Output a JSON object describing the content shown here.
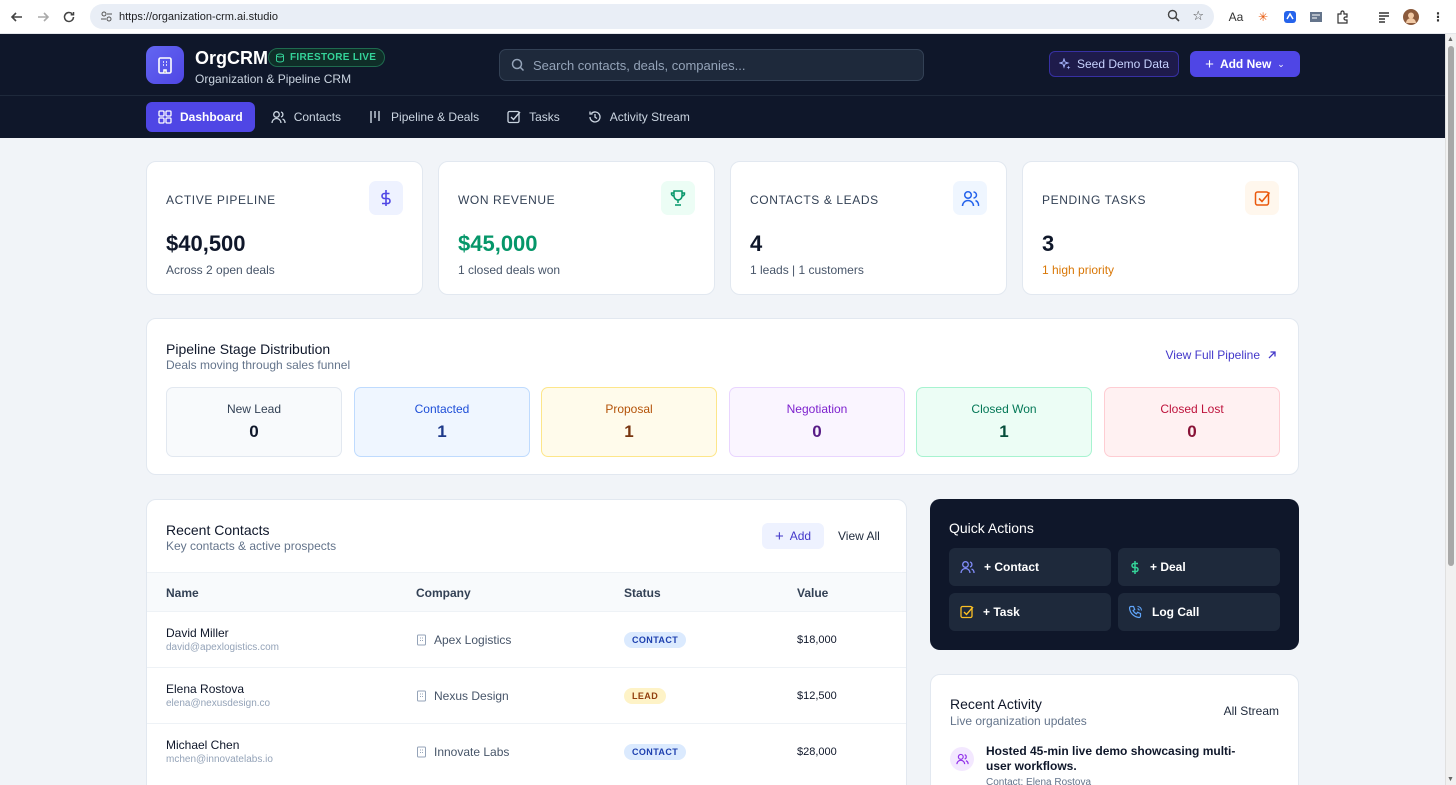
{
  "browser": {
    "url": "https://organization-crm.ai.studio"
  },
  "header": {
    "brand": "OrgCRM",
    "live_badge": "FIRESTORE LIVE",
    "subtitle": "Organization & Pipeline CRM",
    "search_placeholder": "Search contacts, deals, companies...",
    "seed_label": "Seed Demo Data",
    "add_label": "Add New"
  },
  "tabs": [
    {
      "label": "Dashboard",
      "active": true
    },
    {
      "label": "Contacts"
    },
    {
      "label": "Pipeline & Deals"
    },
    {
      "label": "Tasks"
    },
    {
      "label": "Activity Stream"
    }
  ],
  "stats": [
    {
      "label": "ACTIVE PIPELINE",
      "value": "$40,500",
      "sub": "Across 2 open deals"
    },
    {
      "label": "WON REVENUE",
      "value": "$45,000",
      "sub": "1 closed deals won"
    },
    {
      "label": "CONTACTS & LEADS",
      "value": "4",
      "sub": "1 leads | 1 customers"
    },
    {
      "label": "PENDING TASKS",
      "value": "3",
      "sub": "1 high priority"
    }
  ],
  "pipeline": {
    "title": "Pipeline Stage Distribution",
    "subtitle": "Deals moving through sales funnel",
    "link": "View Full Pipeline",
    "stages": [
      {
        "name": "New Lead",
        "count": "0"
      },
      {
        "name": "Contacted",
        "count": "1"
      },
      {
        "name": "Proposal",
        "count": "1"
      },
      {
        "name": "Negotiation",
        "count": "0"
      },
      {
        "name": "Closed Won",
        "count": "1"
      },
      {
        "name": "Closed Lost",
        "count": "0"
      }
    ]
  },
  "contacts": {
    "title": "Recent Contacts",
    "subtitle": "Key contacts & active prospects",
    "add_label": "Add",
    "view_all": "View All",
    "columns": [
      "Name",
      "Company",
      "Status",
      "Value"
    ],
    "rows": [
      {
        "name": "David Miller",
        "email": "david@apexlogistics.com",
        "company": "Apex Logistics",
        "status": "CONTACT",
        "value": "$18,000"
      },
      {
        "name": "Elena Rostova",
        "email": "elena@nexusdesign.co",
        "company": "Nexus Design",
        "status": "LEAD",
        "value": "$12,500"
      },
      {
        "name": "Michael Chen",
        "email": "mchen@innovatelabs.io",
        "company": "Innovate Labs",
        "status": "CONTACT",
        "value": "$28,000"
      }
    ]
  },
  "quick_actions": {
    "title": "Quick Actions",
    "items": [
      "+ Contact",
      "+ Deal",
      "+ Task",
      "Log Call"
    ]
  },
  "activity": {
    "title": "Recent Activity",
    "subtitle": "Live organization updates",
    "link": "All Stream",
    "items": [
      {
        "text": "Hosted 45-min live demo showcasing multi-user workflows.",
        "meta": "Contact: Elena Rostova"
      }
    ]
  }
}
